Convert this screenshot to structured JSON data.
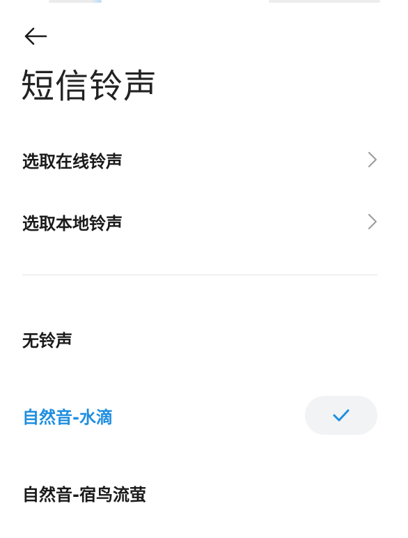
{
  "header": {
    "title": "短信铃声",
    "back_icon": "arrow-left-icon"
  },
  "sources": [
    {
      "label": "选取在线铃声",
      "icon": "chevron-right-icon"
    },
    {
      "label": "选取本地铃声",
      "icon": "chevron-right-icon"
    }
  ],
  "ringtones": [
    {
      "label": "无铃声",
      "selected": false
    },
    {
      "label": "自然音-水滴",
      "selected": true
    },
    {
      "label": "自然音-宿鸟流萤",
      "selected": false
    }
  ],
  "colors": {
    "accent": "#1e8ee0",
    "text": "#1a1a1a",
    "divider": "#e4e4e4",
    "pill": "#f2f3f5"
  }
}
